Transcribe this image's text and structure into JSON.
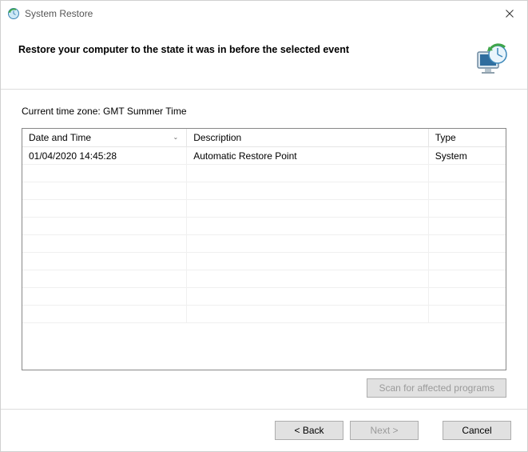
{
  "window": {
    "title": "System Restore"
  },
  "header": {
    "heading": "Restore your computer to the state it was in before the selected event"
  },
  "timezone": {
    "label": "Current time zone: ",
    "value": "GMT Summer Time"
  },
  "table": {
    "columns": {
      "datetime": "Date and Time",
      "description": "Description",
      "type": "Type"
    },
    "rows": [
      {
        "datetime": "01/04/2020 14:45:28",
        "description": "Automatic Restore Point",
        "type": "System"
      }
    ],
    "sort_column": "datetime",
    "sort_dir": "desc"
  },
  "buttons": {
    "scan": "Scan for affected programs",
    "back": "< Back",
    "next": "Next >",
    "cancel": "Cancel"
  },
  "state": {
    "scan_enabled": false,
    "next_enabled": false
  }
}
